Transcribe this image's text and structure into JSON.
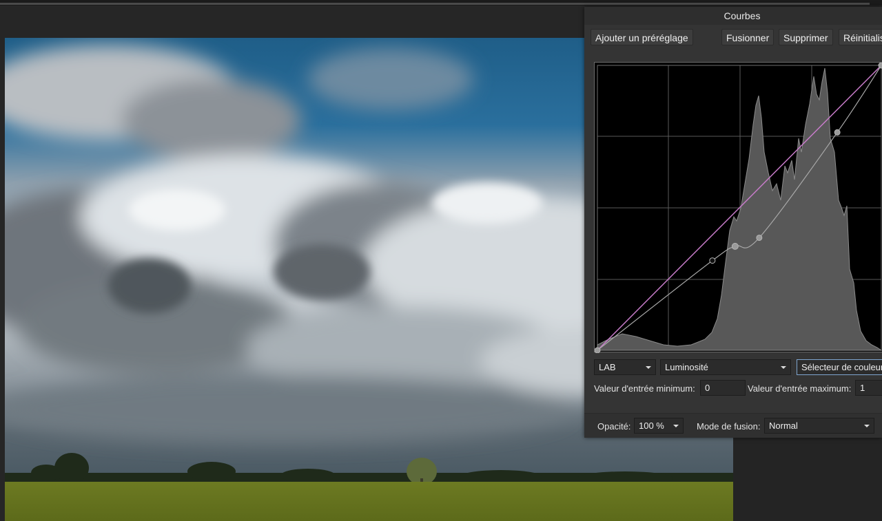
{
  "panel": {
    "title": "Courbes",
    "buttons": {
      "add_preset": "Ajouter un préréglage",
      "merge": "Fusionner",
      "delete": "Supprimer",
      "reset": "Réinitialiser"
    },
    "colour_space": "LAB",
    "channel": "Luminosité",
    "picker": "Sélecteur de couleur",
    "min_input_label": "Valeur d'entrée minimum:",
    "min_input_value": "0",
    "max_input_label": "Valeur d'entrée maximum:",
    "max_input_value": "1"
  },
  "footer": {
    "opacity_label": "Opacité:",
    "opacity_value": "100 %",
    "blend_label": "Mode de fusion:",
    "blend_value": "Normal"
  },
  "colors": {
    "curve_master": "#c77bc9",
    "curve_channel": "#a9a9a9",
    "histogram": "#585858"
  },
  "curve": {
    "control_points": [
      [
        0,
        0
      ],
      [
        0.405,
        0.315
      ],
      [
        0.485,
        0.365
      ],
      [
        0.57,
        0.395
      ],
      [
        0.845,
        0.765
      ],
      [
        1,
        1
      ]
    ]
  }
}
